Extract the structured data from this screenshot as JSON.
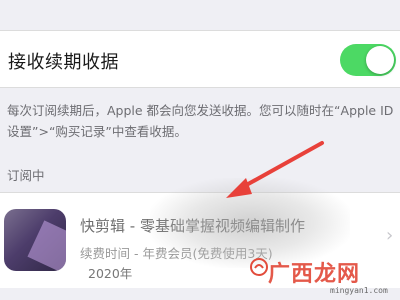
{
  "settings": {
    "receipt_toggle_label": "接收续期收据",
    "receipt_toggle_on": true,
    "description": "每次订阅续期后，Apple 都会向您发送收据。您可以随时在“Apple ID 设置”>“购买记录”中查看收据。",
    "section_header": "订阅中"
  },
  "subscription": {
    "title": "快剪辑 - 零基础掌握视频编辑制作",
    "plan": "续费时间 - 年费会员(免费使用3天)",
    "year": "2020年",
    "chevron": "›"
  },
  "watermark": {
    "text": "广西龙网",
    "url": "mingyan1.com"
  },
  "colors": {
    "toggle_on": "#4cd964",
    "background": "#efeff4",
    "arrow": "#e8413a",
    "watermark": "#e24b3b"
  },
  "icons": {
    "app_icon": "video-editor-app-icon",
    "chevron": "chevron-right-icon",
    "arrow": "red-annotation-arrow",
    "watermark_logo": "watermark-logo-icon"
  }
}
